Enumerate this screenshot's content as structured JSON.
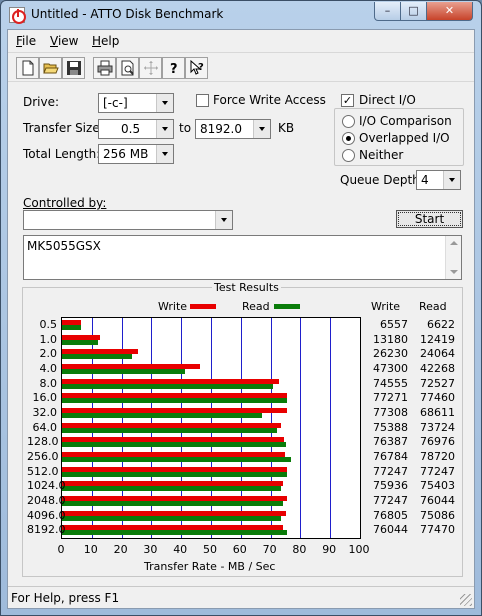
{
  "window": {
    "title": "Untitled - ATTO Disk Benchmark",
    "min": "–",
    "max": "□",
    "close": "✕"
  },
  "menu": [
    {
      "label_pre": "",
      "label_ul": "F",
      "label_post": "ile"
    },
    {
      "label_pre": "",
      "label_ul": "V",
      "label_post": "iew"
    },
    {
      "label_pre": "",
      "label_ul": "H",
      "label_post": "elp"
    }
  ],
  "toolbar": {
    "icons": [
      "new-icon",
      "open-icon",
      "save-icon",
      "print-icon",
      "print-preview-icon",
      "move-icon",
      "help-icon",
      "context-help-icon"
    ]
  },
  "settings": {
    "drive_label": "Drive:",
    "drive_value": "[-c-]",
    "force_write_label": "Force Write Access",
    "force_write_checked": false,
    "direct_io_label": "Direct I/O",
    "direct_io_checked": true,
    "transfer_size_label": "Transfer Size:",
    "transfer_from": "0.5",
    "transfer_to_label": "to",
    "transfer_to": "8192.0",
    "transfer_unit": "KB",
    "total_length_label": "Total Length:",
    "total_length_value": "256 MB",
    "io_options": [
      "I/O Comparison",
      "Overlapped I/O",
      "Neither"
    ],
    "io_selected": 1,
    "queue_depth_label": "Queue Depth:",
    "queue_depth_value": "4",
    "controlled_by_label": "Controlled by:",
    "controlled_by_value": "",
    "start_label": "Start",
    "description": "MK5055GSX"
  },
  "results": {
    "title": "Test Results",
    "write_legend": "Write",
    "read_legend": "Read",
    "write_col": "Write",
    "read_col": "Read",
    "xlabel": "Transfer Rate - MB / Sec",
    "colors": {
      "write": "#e80000",
      "read": "#0a7c0a",
      "grid": "#1f1fcc"
    }
  },
  "chart_data": {
    "type": "bar",
    "orientation": "horizontal",
    "categories": [
      "0.5",
      "1.0",
      "2.0",
      "4.0",
      "8.0",
      "16.0",
      "32.0",
      "64.0",
      "128.0",
      "256.0",
      "512.0",
      "1024.0",
      "2048.0",
      "4096.0",
      "8192.0"
    ],
    "series": [
      {
        "name": "Write",
        "values": [
          6557,
          13180,
          26230,
          47300,
          74555,
          77271,
          77308,
          75388,
          76387,
          76784,
          77247,
          75936,
          77247,
          76805,
          76044
        ]
      },
      {
        "name": "Read",
        "values": [
          6622,
          12419,
          24064,
          42268,
          72527,
          77460,
          68611,
          73724,
          76976,
          78720,
          77247,
          75403,
          76044,
          75086,
          77470
        ]
      }
    ],
    "xlim": [
      0,
      100
    ],
    "xticks": [
      "0",
      "10",
      "20",
      "30",
      "40",
      "50",
      "60",
      "70",
      "80",
      "90",
      "100"
    ],
    "xlabel": "Transfer Rate - MB / Sec",
    "legend": "top"
  },
  "status": {
    "text": "For Help, press F1"
  }
}
